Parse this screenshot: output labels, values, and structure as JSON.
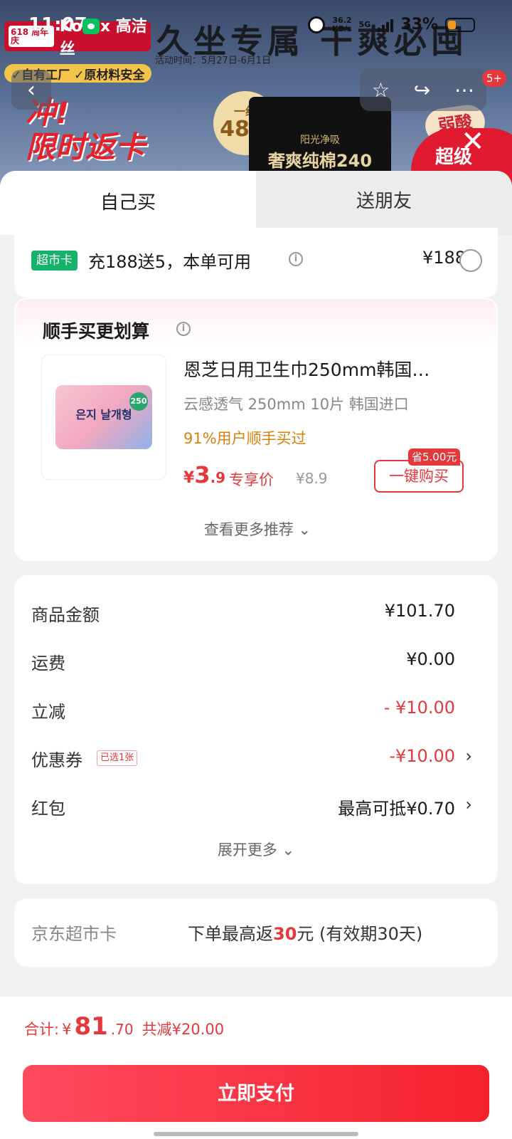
{
  "status_bar": {
    "time": "11:07",
    "net_speed_value": "36.2",
    "net_speed_unit": "KB/s",
    "network": "5G",
    "battery_pct": "33%",
    "battery_level": 0.33
  },
  "banner": {
    "brand_badge": "618 周年庆",
    "brand_name": "Kotex 高洁丝",
    "headline": "久坐专属 干爽必囤",
    "activity_time": "活动时间：5月27日-6月1日",
    "badges": "✓自有工厂 ✓原材料安全",
    "promo_line1": "冲!",
    "promo_line2": "限时返卡",
    "circle_top": "一组",
    "circle_big": "48片",
    "pack_small": "阳光净吸",
    "pack_big": "奢爽纯棉240",
    "ruo": "弱酸",
    "super": "超级",
    "more_badge": "5+"
  },
  "tabs": {
    "self_buy": "自己买",
    "gift": "送朋友"
  },
  "supermarket_card": {
    "tag": "超市卡",
    "text": "充188送5，本单可用",
    "price": "¥188"
  },
  "addon": {
    "title": "顺手买更划算",
    "product": {
      "image_text": "은지 날개형",
      "image_badge": "250",
      "name": "恩芝日用卫生巾250mm韩国…",
      "spec": "云感透气 250mm 10片 韩国进口",
      "pct": "91%用户顺手买过",
      "price_sym": "¥",
      "price_int": "3",
      "price_dec": ".9",
      "price_tag": "专享价",
      "orig_price": "¥8.9",
      "save_tag": "省5.00元",
      "buy_label": "一键购买"
    },
    "more": "查看更多推荐 ⌄"
  },
  "summary": {
    "rows": [
      {
        "label": "商品金额",
        "value": "¥101.70"
      },
      {
        "label": "运费",
        "value": "¥0.00"
      },
      {
        "label": "立减",
        "value": "- ¥10.00"
      },
      {
        "label": "优惠券",
        "tag": "已选1张",
        "value": "-¥10.00"
      },
      {
        "label": "红包",
        "value": "最高可抵¥0.70"
      }
    ],
    "expand": "展开更多 ⌄"
  },
  "jd_card": {
    "label": "京东超市卡",
    "prefix": "下单最高返",
    "amount": "30",
    "suffix": "元 (有效期30天)"
  },
  "bottom": {
    "total_label": "合计:",
    "total_sym": "¥",
    "total_int": "81",
    "total_dec": ".70",
    "saved": "共减¥20.00",
    "pay_label": "立即支付"
  },
  "icons": {
    "back": "‹",
    "star": "☆",
    "share": "↪",
    "more": "⋯",
    "close": "✕",
    "chevron": "›"
  },
  "colors": {
    "accent_red": "#e4393c",
    "green_tag": "#15b26b",
    "orange_text": "#d7820f"
  }
}
